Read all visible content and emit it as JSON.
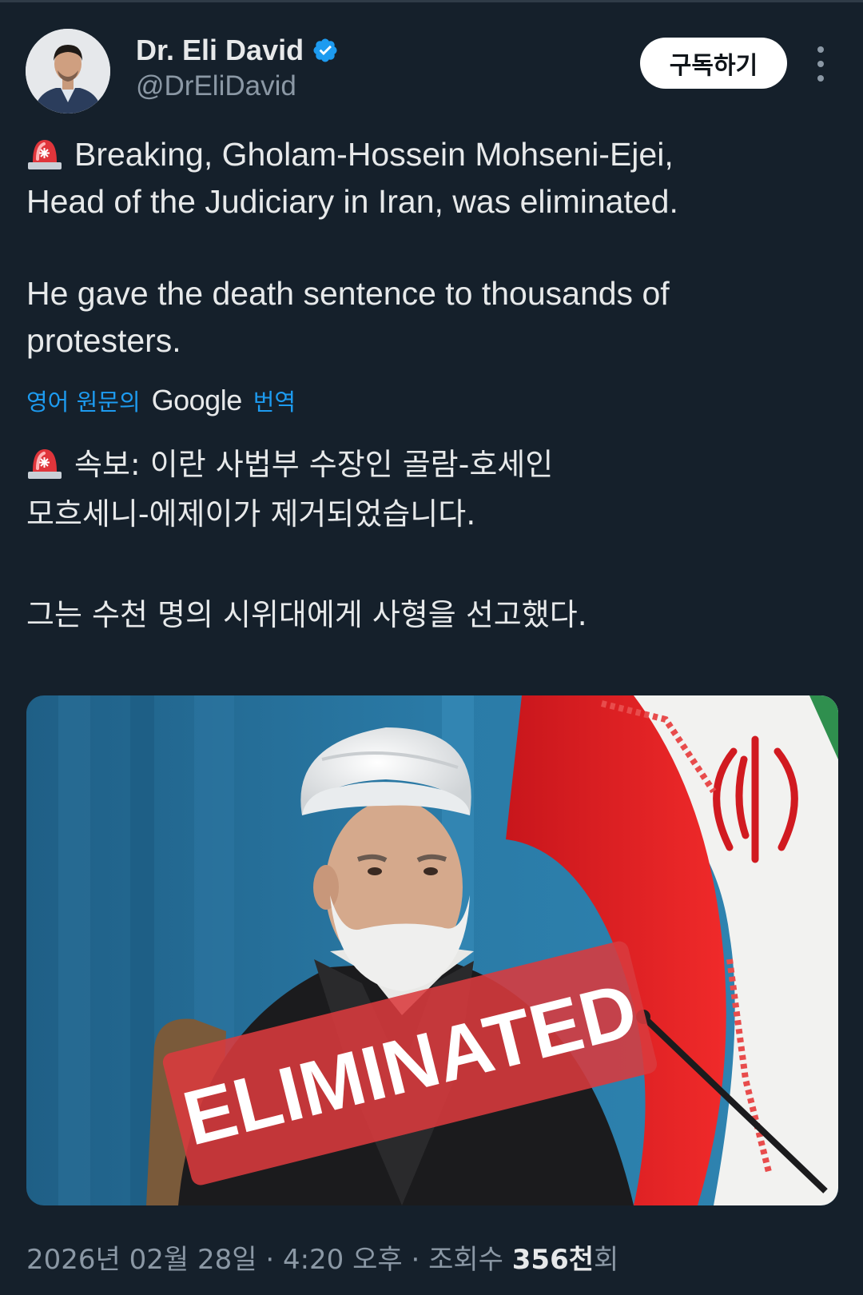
{
  "author": {
    "display_name": "Dr. Eli David",
    "handle": "@DrEliDavid",
    "verified": true
  },
  "actions": {
    "subscribe_label": "구독하기",
    "more_icon": "more-vertical-icon"
  },
  "tweet": {
    "siren_icon": "police-siren-emoji",
    "original_line1": "Breaking, Gholam-Hossein Mohseni-Ejei,",
    "original_line2": "Head of the Judiciary in Iran, was eliminated.",
    "original_line3": "He gave the death sentence to thousands of",
    "original_line4": "protesters.",
    "translation_prefix": "영어 원문의",
    "translation_brand": "Google",
    "translation_suffix": "번역",
    "translated_line1": "속보: 이란 사법부 수장인 골람-호세인",
    "translated_line2": "모흐세니-에제이가 제거되었습니다.",
    "translated_line3": "그는 수천 명의 시위대에게 사형을 선고했다."
  },
  "media": {
    "stamp_text": "ELIMINATED"
  },
  "meta": {
    "date": "2026년 02월 28일",
    "sep1": "·",
    "time": "4:20 오후",
    "sep2": "·",
    "views_prefix": "조회수",
    "views_count": "356천",
    "views_suffix": "회"
  },
  "colors": {
    "background": "#15202b",
    "link": "#1d9bf0",
    "secondary_text": "#8b98a5",
    "verified": "#1d9bf0",
    "stamp_red": "#d93a3e"
  }
}
